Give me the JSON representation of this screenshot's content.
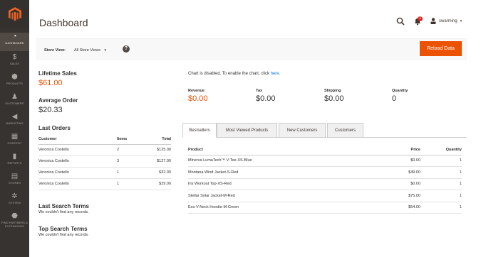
{
  "sidebar": {
    "items": [
      {
        "label": "Dashboard",
        "icon": "dashboard-icon",
        "glyph": "◔"
      },
      {
        "label": "Sales",
        "icon": "dollar-icon",
        "glyph": "$"
      },
      {
        "label": "Products",
        "icon": "cube-icon",
        "glyph": "⬢"
      },
      {
        "label": "Customers",
        "icon": "person-icon",
        "glyph": "♟"
      },
      {
        "label": "Marketing",
        "icon": "megaphone-icon",
        "glyph": "◀"
      },
      {
        "label": "Content",
        "icon": "layout-icon",
        "glyph": "▦"
      },
      {
        "label": "Reports",
        "icon": "bar-chart-icon",
        "glyph": "▮"
      },
      {
        "label": "Stores",
        "icon": "store-icon",
        "glyph": "▤"
      },
      {
        "label": "System",
        "icon": "gear-icon",
        "glyph": "✲"
      },
      {
        "label": "Find Partners & Extensions",
        "icon": "partners-icon",
        "glyph": "⬣"
      }
    ]
  },
  "header": {
    "title": "Dashboard",
    "notification_count": "1",
    "user_name": "swarming"
  },
  "store_view": {
    "label": "Store View:",
    "selected": "All Store Views",
    "reload_label": "Reload Data"
  },
  "stats": {
    "lifetime_sales_label": "Lifetime Sales",
    "lifetime_sales_value": "$61.00",
    "average_order_label": "Average Order",
    "average_order_value": "$20.33"
  },
  "last_orders": {
    "title": "Last Orders",
    "columns": [
      "Customer",
      "Items",
      "Total"
    ],
    "rows": [
      [
        "Veronica Costello",
        "2",
        "$125.00"
      ],
      [
        "Veronica Costello",
        "3",
        "$127.00"
      ],
      [
        "Veronica Costello",
        "1",
        "$32.00"
      ],
      [
        "Veronica Costello",
        "1",
        "$29.00"
      ]
    ]
  },
  "last_search": {
    "title": "Last Search Terms",
    "empty": "We couldn't find any records."
  },
  "top_search": {
    "title": "Top Search Terms",
    "empty": "We couldn't find any records."
  },
  "chart_note": {
    "text": "Chart is disabled. To enable the chart, click ",
    "link": "here",
    "suffix": "."
  },
  "totals": [
    {
      "label": "Revenue",
      "value": "$0.00"
    },
    {
      "label": "Tax",
      "value": "$0.00"
    },
    {
      "label": "Shipping",
      "value": "$0.00"
    },
    {
      "label": "Quantity",
      "value": "0"
    }
  ],
  "tabs": [
    "Bestsellers",
    "Most Viewed Products",
    "New Customers",
    "Customers"
  ],
  "bestsellers": {
    "columns": [
      "Product",
      "Price",
      "Quantity"
    ],
    "rows": [
      [
        "Minerva LumaTech™ V-Tee-XS-Blue",
        "$0.00",
        "1"
      ],
      [
        "Montana Wind Jacket-S-Red",
        "$49.00",
        "1"
      ],
      [
        "Iris Workout Top-XS-Red",
        "$0.00",
        "1"
      ],
      [
        "Stellar Solar Jacket-M-Red",
        "$75.00",
        "1"
      ],
      [
        "Eos V-Neck Hoodie-M-Green",
        "$54.00",
        "1"
      ]
    ]
  },
  "colors": {
    "accent": "#eb5202",
    "sidebar_bg": "#373330",
    "link": "#007bdb"
  }
}
